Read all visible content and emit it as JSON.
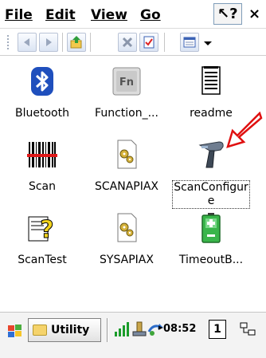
{
  "menubar": {
    "items": [
      {
        "label": "File"
      },
      {
        "label": "Edit"
      },
      {
        "label": "View"
      },
      {
        "label": "Go"
      }
    ],
    "help_icon": "help-pointer-icon",
    "close_label": "×"
  },
  "toolbar": {
    "buttons": [
      "back-icon",
      "forward-icon",
      "up-folder-icon",
      "delete-icon",
      "properties-icon",
      "views-icon"
    ]
  },
  "desktop": {
    "icons": [
      {
        "label": "Bluetooth",
        "icon": "bluetooth-icon"
      },
      {
        "label": "Function_...",
        "icon": "fn-key-icon"
      },
      {
        "label": "readme",
        "icon": "document-icon"
      },
      {
        "label": "Scan",
        "icon": "barcode-icon"
      },
      {
        "label": "SCANAPIAX",
        "icon": "gear-document-icon"
      },
      {
        "label": "ScanConfigure",
        "icon": "barcode-scanner-icon",
        "selected": true
      },
      {
        "label": "ScanTest",
        "icon": "help-file-icon"
      },
      {
        "label": "SYSAPIAX",
        "icon": "gear-document-icon"
      },
      {
        "label": "TimeoutB...",
        "icon": "battery-icon"
      }
    ]
  },
  "annotation": {
    "color": "#e01010"
  },
  "taskbar": {
    "utility_label": "Utility",
    "clock": "08:52",
    "kb_label": "1"
  },
  "colors": {
    "accent": "#2b5fb8",
    "selection_border": "#333333"
  }
}
